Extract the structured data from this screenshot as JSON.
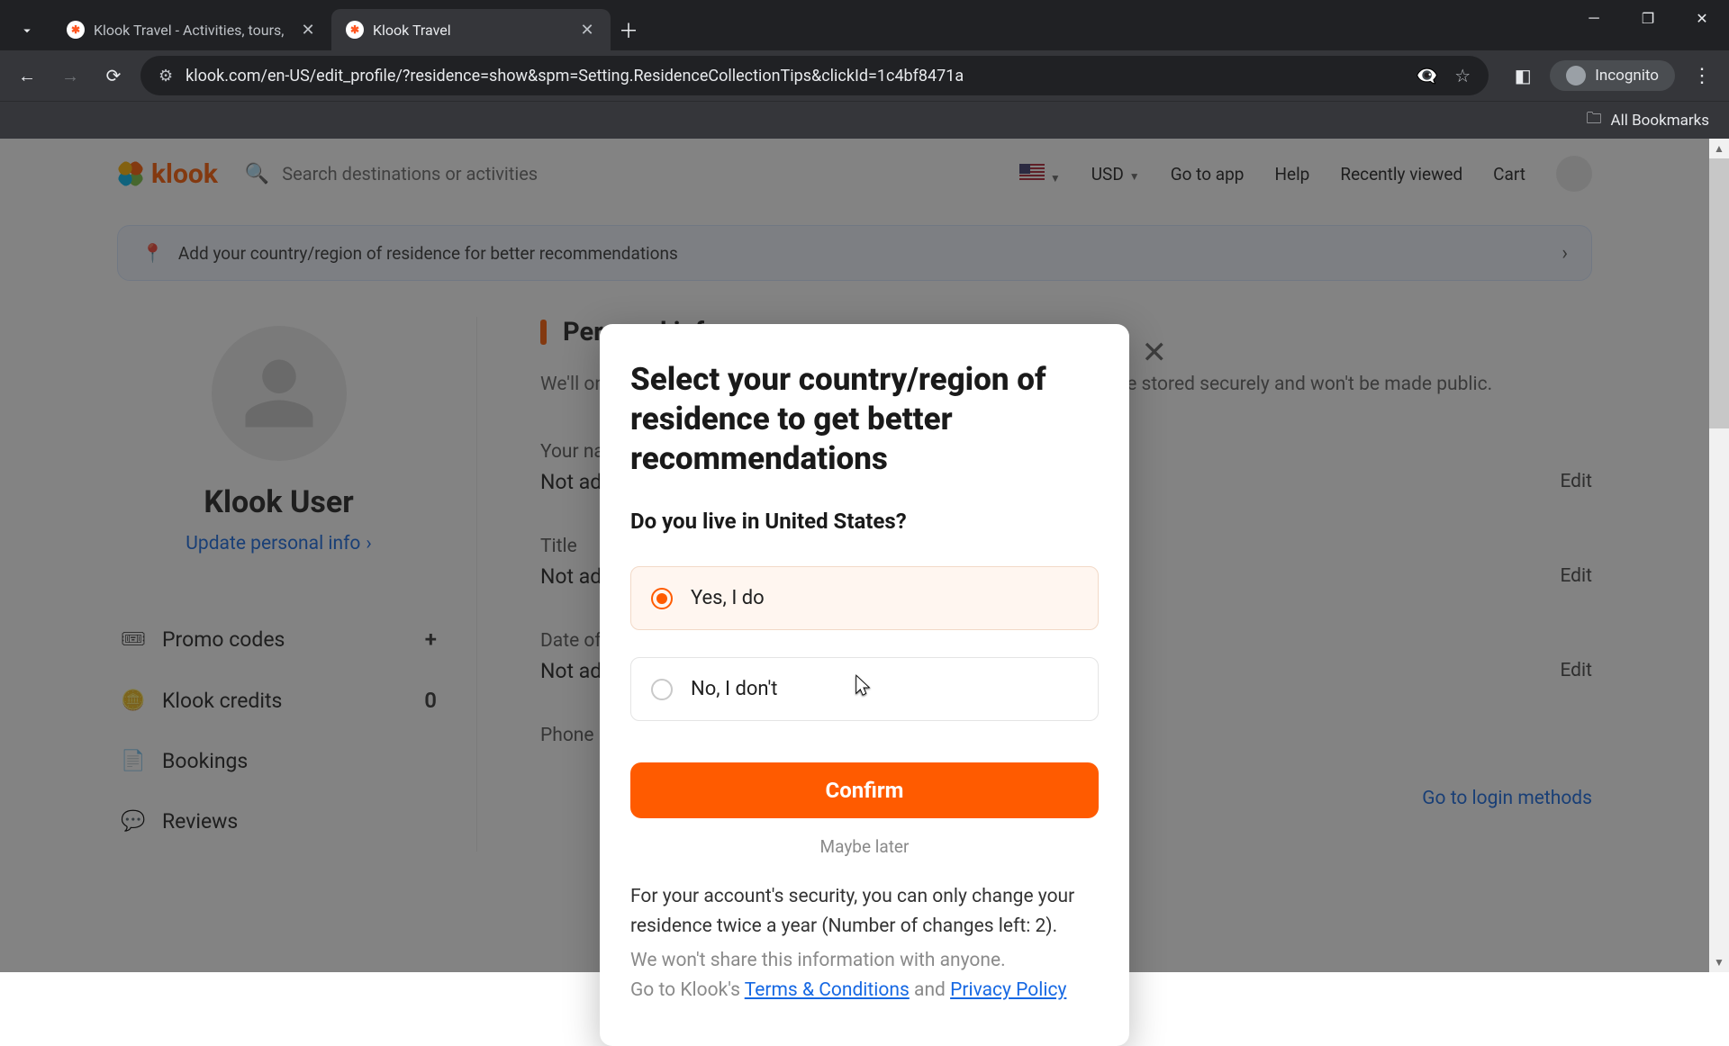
{
  "browser": {
    "tabs": [
      {
        "title": "Klook Travel - Activities, tours,"
      },
      {
        "title": "Klook Travel"
      }
    ],
    "url": "klook.com/en-US/edit_profile/?residence=show&spm=Setting.ResidenceCollectionTips&clickId=1c4bf8471a",
    "incognito_label": "Incognito",
    "all_bookmarks": "All Bookmarks"
  },
  "header": {
    "logo_text": "klook",
    "search_placeholder": "Search destinations or activities",
    "currency": "USD",
    "nav": {
      "go_to_app": "Go to app",
      "help": "Help",
      "recently_viewed": "Recently viewed",
      "cart": "Cart"
    }
  },
  "banner": {
    "text": "Add your country/region of residence for better recommendations"
  },
  "sidebar": {
    "username": "Klook User",
    "update_link": "Update personal info",
    "items": [
      {
        "icon": "🎟",
        "label": "Promo codes",
        "trail": "+"
      },
      {
        "icon": "🪙",
        "label": "Klook credits",
        "trail": "0"
      },
      {
        "icon": "📄",
        "label": "Bookings",
        "trail": ""
      },
      {
        "icon": "💬",
        "label": "Reviews",
        "trail": ""
      }
    ]
  },
  "main": {
    "title": "Personal info",
    "subtitle": "We'll only use this information to verify your identity. Your details will be stored securely and won't be made public.",
    "fields": [
      {
        "label": "Your name",
        "value": "Not added",
        "edit": "Edit"
      },
      {
        "label": "Title",
        "value": "Not added",
        "edit": "Edit"
      },
      {
        "label": "Date of birth",
        "value": "Not added",
        "edit": "Edit"
      },
      {
        "label": "Phone",
        "value": "",
        "edit": ""
      }
    ],
    "login_methods": "Go to login methods"
  },
  "modal": {
    "title": "Select your country/region of residence to get better recommendations",
    "question": "Do you live in United States?",
    "option_yes": "Yes, I do",
    "option_no": "No, I don't",
    "confirm": "Confirm",
    "maybe_later": "Maybe later",
    "disclaimer_p1": "For your account's security, you can only change your residence twice a year (Number of changes left: 2).",
    "disclaimer_p2_a": "We won't share this information with anyone.",
    "disclaimer_p2_b": "Go to Klook's ",
    "terms": "Terms & Conditions",
    "and": " and ",
    "privacy": "Privacy Policy"
  }
}
